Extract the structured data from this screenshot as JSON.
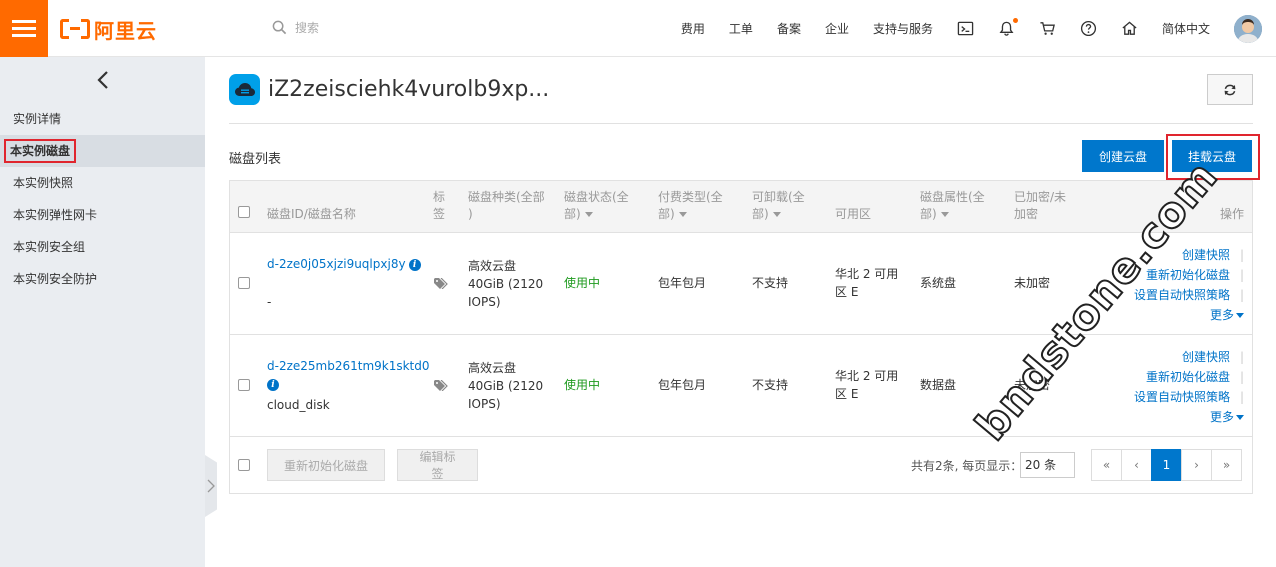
{
  "header": {
    "logo_text": "阿里云",
    "search_placeholder": "搜索",
    "nav": [
      "费用",
      "工单",
      "备案",
      "企业",
      "支持与服务"
    ],
    "language": "简体中文",
    "icons": [
      "terminal-icon",
      "bell-icon",
      "cart-icon",
      "help-icon",
      "home-icon"
    ],
    "accent_color": "#ff6a00"
  },
  "sidebar": {
    "items": [
      {
        "label": "实例详情"
      },
      {
        "label": "本实例磁盘",
        "active": true
      },
      {
        "label": "本实例快照"
      },
      {
        "label": "本实例弹性网卡"
      },
      {
        "label": "本实例安全组"
      },
      {
        "label": "本实例安全防护"
      }
    ]
  },
  "main": {
    "title": "iZ2zeisciehk4vurolb9xp...",
    "list_title": "磁盘列表",
    "create_button": "创建云盘",
    "attach_button": "挂载云盘",
    "columns": {
      "disk_id": "磁盘ID/磁盘名称",
      "tag": "标签",
      "type_1": "磁盘种类(全部",
      "type_2": ")",
      "status_1": "磁盘状态(全",
      "status_2": "部)",
      "billing_1": "付费类型(全",
      "billing_2": "部)",
      "detachable_1": "可卸载(全",
      "detachable_2": "部)",
      "zone": "可用区",
      "attr_1": "磁盘属性(全",
      "attr_2": "部)",
      "encrypted_1": "已加密/未",
      "encrypted_2": "加密",
      "actions": "操作"
    },
    "rows": [
      {
        "id": "d-2ze0j05xjzi9uqlpxj8y",
        "name": "-",
        "type_1": "高效云盘",
        "type_2": "40GiB (2120",
        "type_3": "IOPS)",
        "status": "使用中",
        "billing": "包年包月",
        "detachable": "不支持",
        "zone_1": "华北 2 可用",
        "zone_2": "区 E",
        "attribute": "系统盘",
        "encrypted": "未加密",
        "ops": [
          "创建快照",
          "重新初始化磁盘",
          "设置自动快照策略",
          "更多"
        ]
      },
      {
        "id": "d-2ze25mb261tm9k1sktd0",
        "name": "cloud_disk",
        "type_1": "高效云盘",
        "type_2": "40GiB (2120",
        "type_3": "IOPS)",
        "status": "使用中",
        "billing": "包年包月",
        "detachable": "不支持",
        "zone_1": "华北 2 可用",
        "zone_2": "区 E",
        "attribute": "数据盘",
        "encrypted": "未加密",
        "ops": [
          "创建快照",
          "重新初始化磁盘",
          "设置自动快照策略",
          "更多"
        ]
      }
    ],
    "footer": {
      "reinit_button": "重新初始化磁盘",
      "edit_tags_button": "编辑标签",
      "total_text": "共有2条, 每页显示：",
      "page_size": "20",
      "page_size_suffix": "条",
      "pages": [
        "«",
        "‹",
        "1",
        "›",
        "»"
      ],
      "current_page": "1"
    }
  },
  "watermark": "bndstone.com"
}
